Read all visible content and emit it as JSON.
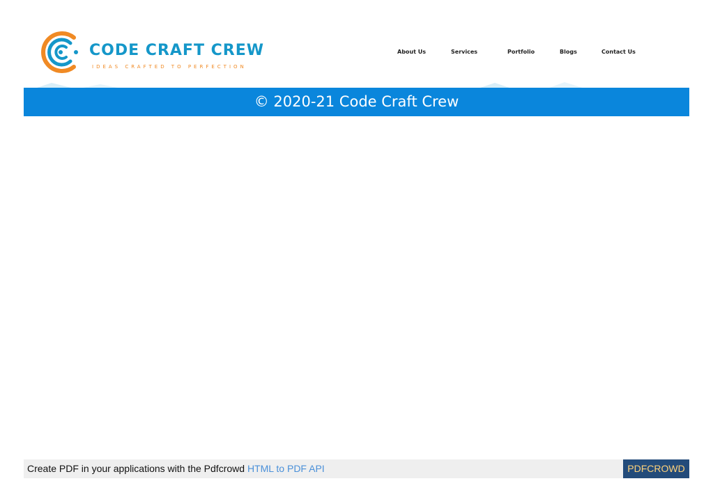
{
  "header": {
    "logo": {
      "title": "CODE CRAFT CREW",
      "tagline": "IDEAS CRAFTED TO PERFECTION"
    },
    "nav": [
      {
        "label": "About Us"
      },
      {
        "label": "Services"
      },
      {
        "label": "Portfolio"
      },
      {
        "label": "Blogs"
      },
      {
        "label": "Contact Us"
      }
    ]
  },
  "banner": {
    "copyright": "© 2020-21 Code Craft Crew"
  },
  "pdf_footer": {
    "text": "Create PDF in your applications with the Pdfcrowd ",
    "link_label": "HTML to PDF API",
    "badge_label": "PDFCROWD"
  },
  "colors": {
    "brand_blue": "#1597c9",
    "brand_orange": "#f08a24",
    "banner_blue": "#0a86dc",
    "pdf_badge": "#234b7a"
  },
  "icons": {
    "logo_mark": "concentric-c-logo-icon"
  }
}
